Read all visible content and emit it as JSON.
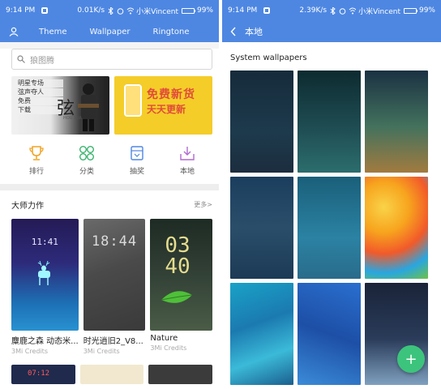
{
  "left_phone": {
    "status": {
      "time": "9:14 PM",
      "speed": "0.01K/s",
      "carrier": "小米Vincent",
      "battery": "99%",
      "battery_level": 0.99
    },
    "tabs": [
      "Theme",
      "Wallpaper",
      "Ringtone"
    ],
    "search": {
      "placeholder": "狼图腾"
    },
    "banner1": {
      "lines": [
        "明星专场",
        "弦声夺人",
        "免费",
        "下载"
      ],
      "big": "弦",
      "small": "HOU XUAN"
    },
    "banner2": {
      "title": "免费新货",
      "subtitle": "天天更新"
    },
    "quick_links": [
      {
        "label": "排行",
        "icon": "trophy-icon",
        "color": "#f0a422"
      },
      {
        "label": "分类",
        "icon": "grid-circles-icon",
        "color": "#36b26b"
      },
      {
        "label": "抽奖",
        "icon": "ticket-icon",
        "color": "#4e87e2"
      },
      {
        "label": "本地",
        "icon": "download-tray-icon",
        "color": "#b06ad0"
      }
    ],
    "section": {
      "title": "大师力作",
      "more": "更多>"
    },
    "cards": [
      {
        "name": "麋鹿之森 动态米...",
        "price": "3Mi Credits",
        "clock": "11:41"
      },
      {
        "name": "时光逍旧2_V8...",
        "price": "3Mi Credits",
        "clock": "18:44"
      },
      {
        "name": "Nature",
        "price": "3Mi Credits",
        "clock": "03\n40"
      }
    ],
    "bottom_clock": "07:12"
  },
  "right_phone": {
    "status": {
      "time": "9:14 PM",
      "speed": "2.39K/s",
      "carrier": "小米Vincent",
      "battery": "99%",
      "battery_level": 0.99
    },
    "title": "本地",
    "section_title": "System wallpapers",
    "wallpapers": 9,
    "fab_label": "+"
  },
  "colors": {
    "primary": "#4e87e2",
    "fab": "#3cc47c"
  }
}
